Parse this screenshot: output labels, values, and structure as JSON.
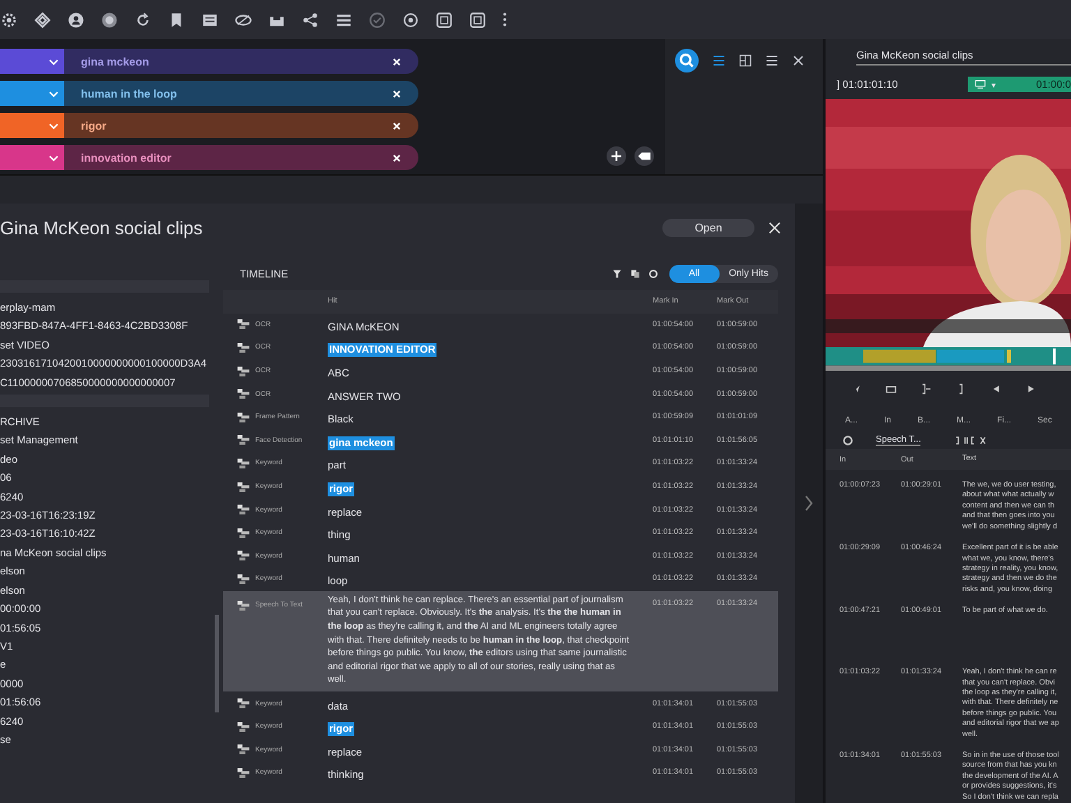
{
  "search_tags": [
    {
      "text": "gina mckeon",
      "color": "#5b4bd6"
    },
    {
      "text": "human in the loop",
      "color": "#1e8fe0"
    },
    {
      "text": "rigor",
      "color": "#f06426"
    },
    {
      "text": "innovation editor",
      "color": "#d8368a"
    }
  ],
  "dialog": {
    "title": "Gina McKeon social clips",
    "open_button": "Open",
    "metadata_groups": [
      [
        "erplay-mam",
        "893FBD-847A-4FF1-8463-4C2BD3308F",
        "set VIDEO",
        "2303161710420010000000000100000D3A4C11000000706850000000000000007"
      ],
      [
        "RCHIVE",
        "set Management",
        "deo",
        "06",
        "6240",
        "23-03-16T16:23:19Z",
        "23-03-16T16:10:42Z",
        "na McKeon social clips",
        "elson",
        "elson",
        "00:00:00",
        "01:56:05",
        "V1",
        "e",
        "0000",
        "01:56:06",
        "6240",
        "se"
      ]
    ],
    "timeline": {
      "heading": "TIMELINE",
      "filters": [
        {
          "label": "All",
          "selected": true
        },
        {
          "label": "Only Hits",
          "selected": false
        }
      ],
      "columns": [
        "Hit",
        "Mark In",
        "Mark Out"
      ],
      "rows": [
        {
          "type": "OCR",
          "hit": "GINA McKEON",
          "mark_in": "01:00:54:00",
          "mark_out": "01:00:59:00",
          "highlighted": false,
          "selected": false
        },
        {
          "type": "OCR",
          "hit": "INNOVATION EDITOR",
          "mark_in": "01:00:54:00",
          "mark_out": "01:00:59:00",
          "highlighted": true,
          "selected": false
        },
        {
          "type": "OCR",
          "hit": "ABC",
          "mark_in": "01:00:54:00",
          "mark_out": "01:00:59:00",
          "highlighted": false,
          "selected": false
        },
        {
          "type": "OCR",
          "hit": "ANSWER TWO",
          "mark_in": "01:00:54:00",
          "mark_out": "01:00:59:00",
          "highlighted": false,
          "selected": false
        },
        {
          "type": "Frame Pattern",
          "hit": "Black",
          "mark_in": "01:00:59:09",
          "mark_out": "01:01:01:09",
          "highlighted": false,
          "selected": false
        },
        {
          "type": "Face Detection",
          "hit": "gina mckeon",
          "mark_in": "01:01:01:10",
          "mark_out": "01:01:56:05",
          "highlighted": true,
          "selected": false
        },
        {
          "type": "Keyword",
          "hit": "part",
          "mark_in": "01:01:03:22",
          "mark_out": "01:01:33:24",
          "highlighted": false,
          "selected": false
        },
        {
          "type": "Keyword",
          "hit": "rigor",
          "mark_in": "01:01:03:22",
          "mark_out": "01:01:33:24",
          "highlighted": true,
          "selected": false
        },
        {
          "type": "Keyword",
          "hit": "replace",
          "mark_in": "01:01:03:22",
          "mark_out": "01:01:33:24",
          "highlighted": false,
          "selected": false
        },
        {
          "type": "Keyword",
          "hit": "thing",
          "mark_in": "01:01:03:22",
          "mark_out": "01:01:33:24",
          "highlighted": false,
          "selected": false
        },
        {
          "type": "Keyword",
          "hit": "human",
          "mark_in": "01:01:03:22",
          "mark_out": "01:01:33:24",
          "highlighted": false,
          "selected": false
        },
        {
          "type": "Keyword",
          "hit": "loop",
          "mark_in": "01:01:03:22",
          "mark_out": "01:01:33:24",
          "highlighted": false,
          "selected": false
        },
        {
          "type": "Speech To Text",
          "hit": "Yeah, I don't think he can replace. There's an essential part of journalism that you can't replace. Obviously. It's **the** analysis. It's **the the human in the loop** as they're calling it, and **the** AI and ML engineers totally agree with that. There definitely needs to be **human in the loop**, that checkpoint before things go public. You know, **the** editors using that same journalistic and editorial rigor that we apply to all of our stories, really using that as well.",
          "mark_in": "01:01:03:22",
          "mark_out": "01:01:33:24",
          "highlighted": false,
          "selected": true
        },
        {
          "type": "Keyword",
          "hit": "data",
          "mark_in": "01:01:34:01",
          "mark_out": "01:01:55:03",
          "highlighted": false,
          "selected": false
        },
        {
          "type": "Keyword",
          "hit": "rigor",
          "mark_in": "01:01:34:01",
          "mark_out": "01:01:55:03",
          "highlighted": true,
          "selected": false
        },
        {
          "type": "Keyword",
          "hit": "replace",
          "mark_in": "01:01:34:01",
          "mark_out": "01:01:55:03",
          "highlighted": false,
          "selected": false
        },
        {
          "type": "Keyword",
          "hit": "thinking",
          "mark_in": "01:01:34:01",
          "mark_out": "01:01:55:03",
          "highlighted": false,
          "selected": false
        }
      ]
    }
  },
  "player": {
    "title": "Gina McKeon social clips",
    "in_marker": "]",
    "timecode": "01:01:01:10",
    "clip_menu": "▾",
    "clip_time": "01:00:0",
    "tabs": [
      "A...",
      "In",
      "B...",
      "M...",
      "Fi...",
      "Sec"
    ],
    "track_select": "Speech T...",
    "columns": [
      "In",
      "Out",
      "Text"
    ],
    "rows": [
      {
        "in": "01:00:07:23",
        "out": "01:00:29:01",
        "text_lines": [
          "The we, we do user testing,",
          "about what what actually w",
          "content and then we can th",
          "and that then goes into you",
          "we'll do something slightly d"
        ]
      },
      {
        "in": "01:00:29:09",
        "out": "01:00:46:24",
        "text_lines": [
          "Excellent part of it is be able",
          "what we, you know, there's",
          "strategy in reality, you know,",
          "strategy and then we do the",
          "risks and, you know, doing"
        ]
      },
      {
        "in": "01:00:47:21",
        "out": "01:00:49:01",
        "text_lines": [
          "To be part of what we do."
        ]
      },
      {
        "in": "01:01:03:22",
        "out": "01:01:33:24",
        "text_lines": [
          "Yeah, I don't think he can re",
          "that you can't replace. Obvi",
          "the loop as they're calling it,",
          "with that. There definitely ne",
          "before things go public. You",
          "and editorial rigor that we ap",
          "well."
        ]
      },
      {
        "in": "01:01:34:01",
        "out": "01:01:55:03",
        "text_lines": [
          "So in in the use of those tool",
          "source from that has you kn",
          "the development of the AI. A",
          "or provides suggestions, it's",
          "So I don't think we can repla"
        ]
      }
    ]
  }
}
